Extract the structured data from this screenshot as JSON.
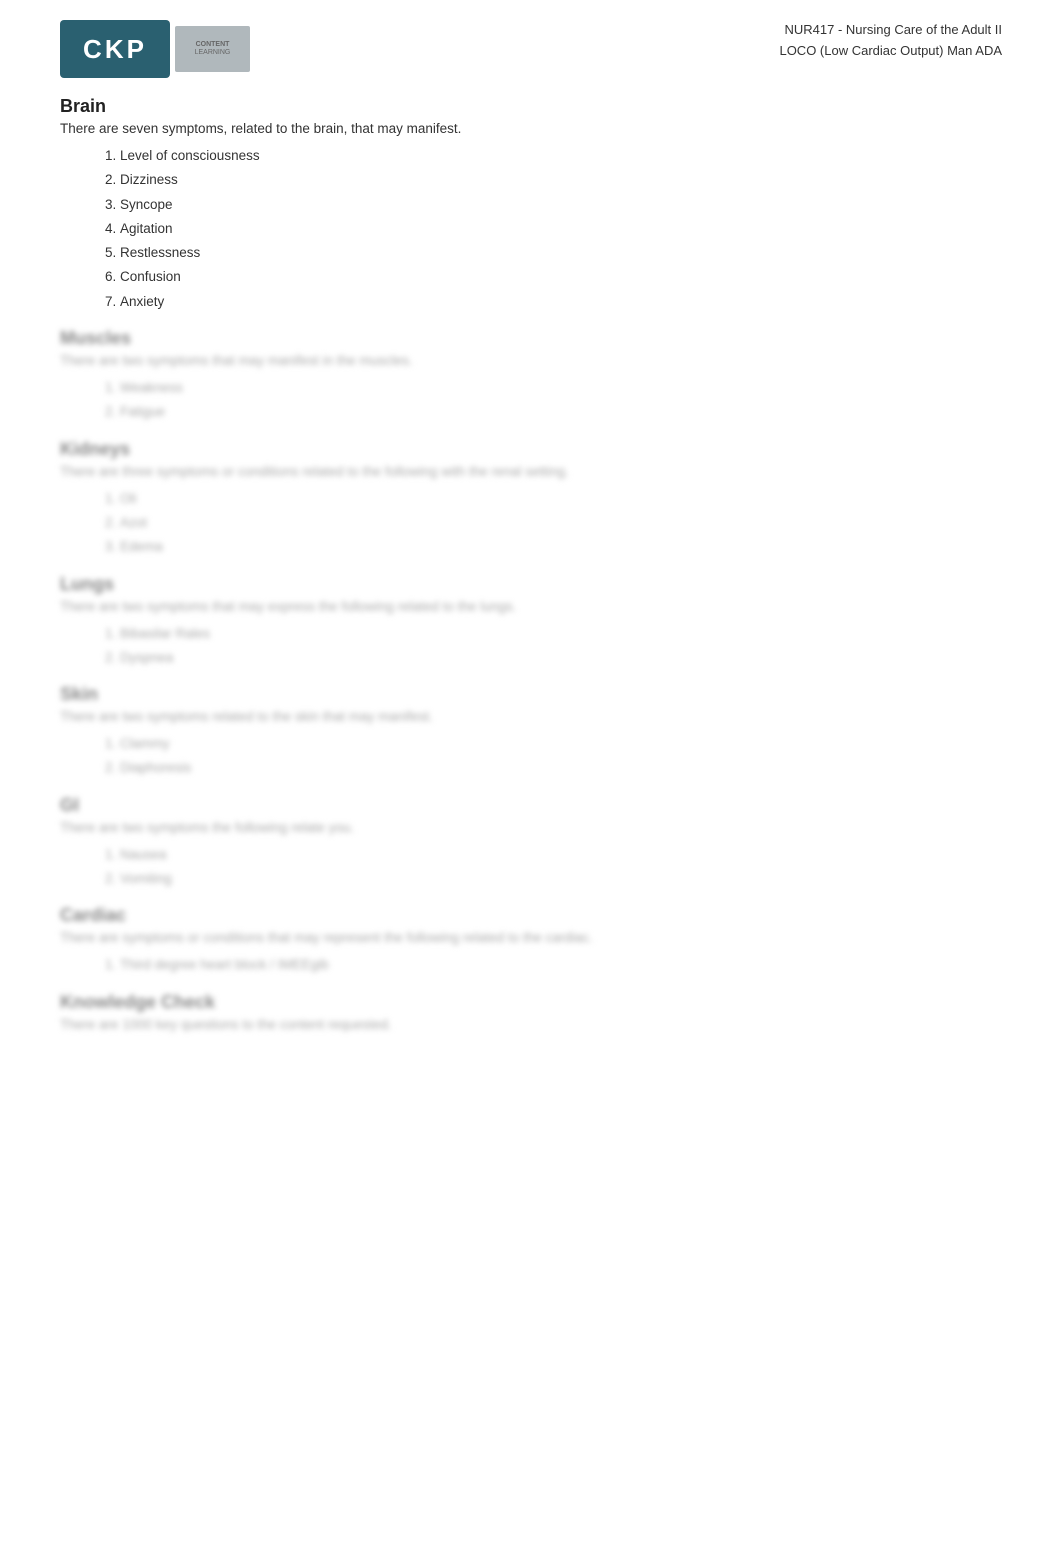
{
  "header": {
    "logo_text": "CKP",
    "course_line1": "NUR417 - Nursing Care of the Adult II",
    "course_line2": "LOCO (Low Cardiac Output) Man ADA"
  },
  "brain_section": {
    "title": "Brain",
    "description": "There are seven symptoms, related to the brain, that may manifest.",
    "symptoms": [
      "Level of consciousness",
      "Dizziness",
      "Syncope",
      "Agitation",
      "Restlessness",
      "Confusion",
      "Anxiety"
    ]
  },
  "muscles_section": {
    "title": "Muscles",
    "description": "There are two symptoms that may manifest in the muscles.",
    "symptoms": [
      "Weakness",
      "Fatigue"
    ]
  },
  "kidneys_section": {
    "title": "Kidneys",
    "description": "There are three symptoms or conditions related to the following with the renal setting.",
    "symptoms": [
      "Oli",
      "Azot",
      "Edema"
    ]
  },
  "lungs_section": {
    "title": "Lungs",
    "description": "There are two symptoms that may express the following related to the lungs.",
    "symptoms": [
      "Bibasilar Rales",
      "Dyspnea"
    ]
  },
  "skin_section": {
    "title": "Skin",
    "description": "There are two symptoms related to the skin that may manifest.",
    "symptoms": [
      "Clammy",
      "Diaphoresis"
    ]
  },
  "gi_section": {
    "title": "GI",
    "description": "There are two symptoms the following relate you.",
    "symptoms": [
      "Nausea",
      "Vomiting"
    ]
  },
  "cardiac_section": {
    "title": "Cardiac",
    "description": "There are symptoms or conditions that may represent the following related to the cardiac.",
    "symptoms": [
      "Third degree heart block / IMEEgib"
    ]
  },
  "knowledge_check_section": {
    "title": "Knowledge Check",
    "description": "There are 1000 key questions to the content requested."
  }
}
